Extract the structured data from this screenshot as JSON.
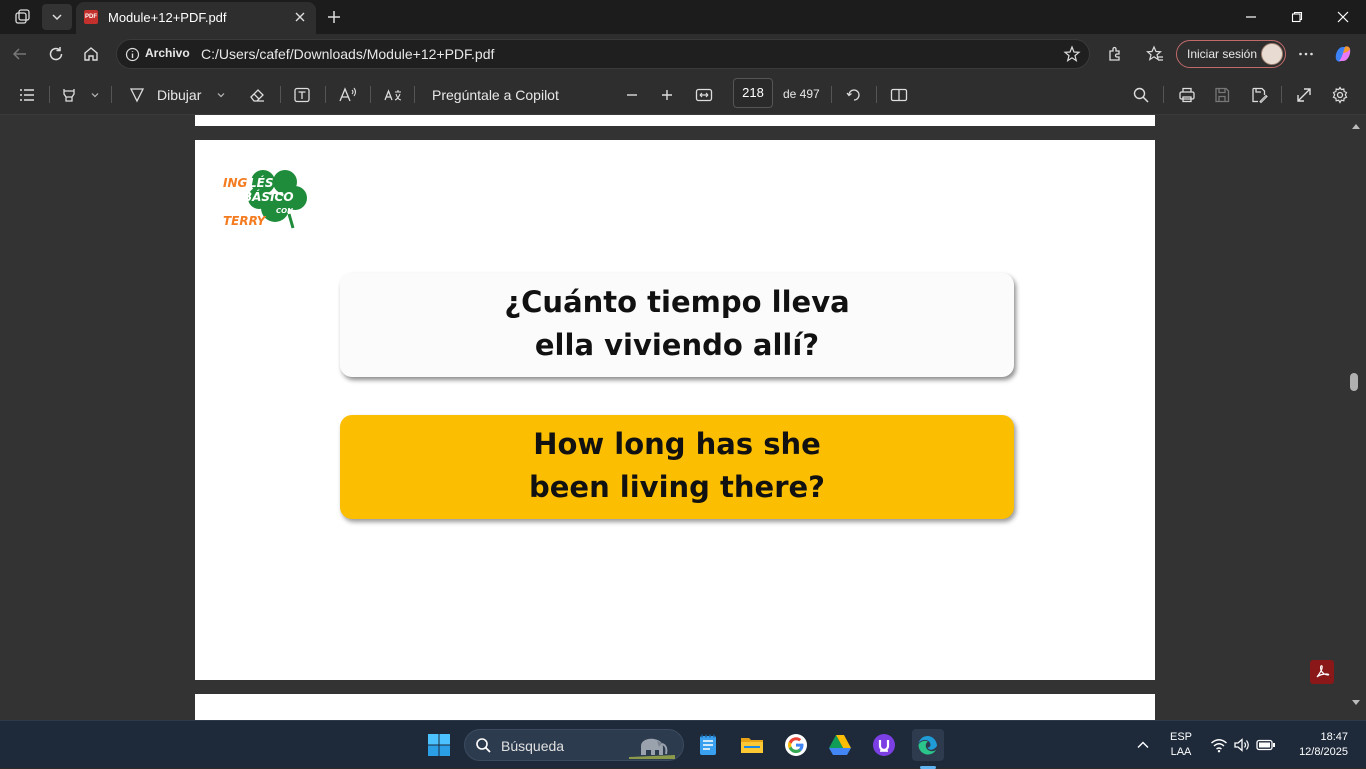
{
  "browser": {
    "tab": {
      "title": "Module+12+PDF.pdf",
      "icon": "pdf-icon"
    },
    "address": {
      "site_chip": "Archivo",
      "url": "C:/Users/cafef/Downloads/Module+12+PDF.pdf"
    },
    "signin_label": "Iniciar sesión"
  },
  "pdf_toolbar": {
    "draw_label": "Dibujar",
    "copilot_label": "Pregúntale a Copilot",
    "current_page": "218",
    "page_total": "de 497"
  },
  "page": {
    "logo": {
      "top_left": "ING",
      "center": "LÉS",
      "main": "BÁSICO",
      "small": "CON",
      "bottom": "TERRY"
    },
    "spanish_line1": "¿Cuánto tiempo lleva",
    "spanish_line2": "ella viviendo allí?",
    "english_line1": "How long has she",
    "english_line2": "been living there?"
  },
  "taskbar": {
    "search_placeholder": "Búsqueda",
    "lang_line1": "ESP",
    "lang_line2": "LAA",
    "time": "18:47",
    "date": "12/8/2025"
  },
  "colors": {
    "english_card": "#fcbe00",
    "logo_green": "#1e8c3a",
    "logo_orange": "#f47b20"
  }
}
